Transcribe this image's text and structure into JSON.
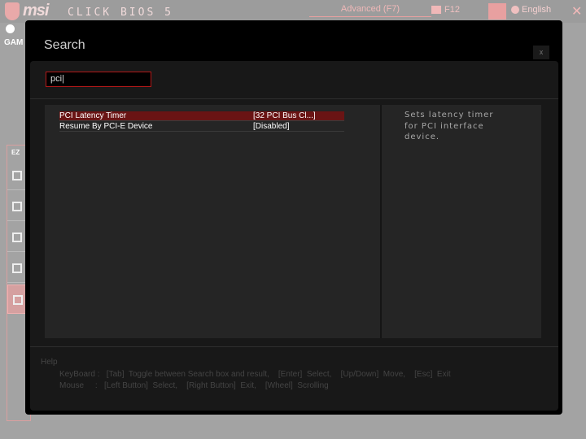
{
  "header": {
    "brand": "msi",
    "product": "CLICK BIOS 5",
    "mode_tab": "Advanced (F7)",
    "screenshot_key": "F12",
    "language": "English",
    "background_labels": {
      "game_boost": "GAM",
      "ez_mode": "EZ"
    }
  },
  "dialog": {
    "title": "Search",
    "close_label": "x",
    "search": {
      "value": "pci|"
    },
    "results": [
      {
        "name": "PCI Latency Timer",
        "value": "[32 PCI Bus Cl...]",
        "selected": true
      },
      {
        "name": "Resume By PCI-E Device",
        "value": "[Disabled]",
        "selected": false
      }
    ],
    "description": "Sets latency timer for PCI interface device.",
    "help": {
      "title": "Help",
      "keyboard": "KeyBoard :   [Tab]  Toggle between Search box and result,    [Enter]  Select,    [Up/Down]  Move,    [Esc]  Exit",
      "mouse": "Mouse     :   [Left Button]  Select,    [Right Button]  Exit,    [Wheel]  Scrolling"
    }
  },
  "colors": {
    "accent": "#b01818",
    "selected_row": "#6a1414"
  }
}
